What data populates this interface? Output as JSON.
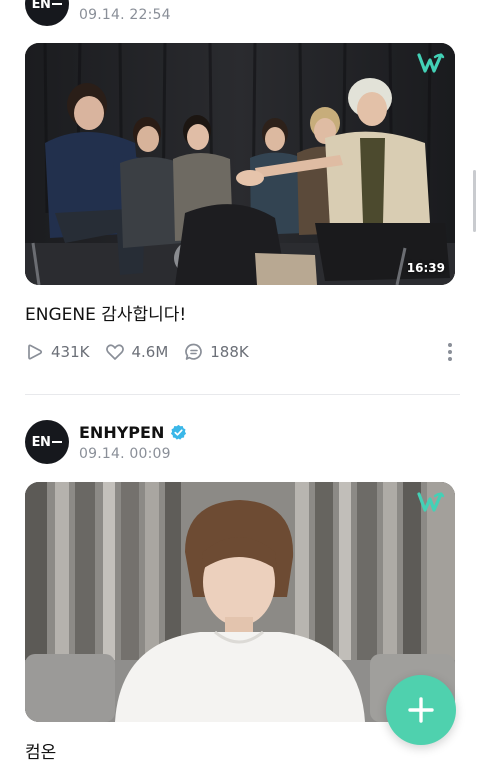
{
  "post1": {
    "avatar_text": "EN",
    "timestamp": "09.14. 22:54",
    "duration": "16:39",
    "caption": "ENGENE 감사합니다!",
    "plays": "431K",
    "likes": "4.6M",
    "comments": "188K"
  },
  "post2": {
    "avatar_text": "EN",
    "author": "ENHYPEN",
    "timestamp": "09.14. 00:09",
    "caption": "컴온"
  },
  "icons": {
    "play": "play-icon",
    "like": "heart-icon",
    "comment": "comment-icon",
    "more": "more-vertical-icon",
    "verified": "verified-badge-icon",
    "fab": "plus-icon"
  },
  "colors": {
    "accent": "#4fd1ae",
    "verified": "#3ab7e8",
    "weverse_logo": "#43d1b6",
    "meta_text": "#8a8f98"
  }
}
